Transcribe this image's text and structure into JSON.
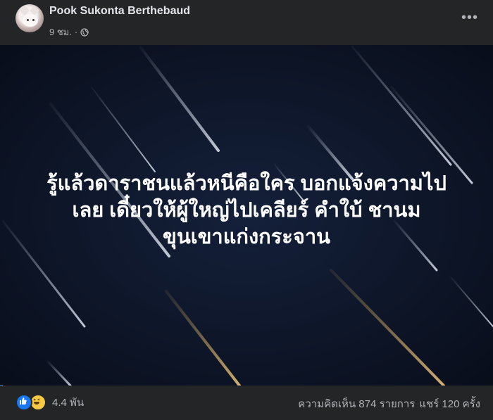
{
  "post": {
    "author": "Pook Sukonta Berthebaud",
    "time": "9 ชม.",
    "separator": "·",
    "privacy_icon": "globe-icon",
    "more_icon": "more-options-icon"
  },
  "image": {
    "caption_lines": [
      "รู้แล้วดาราชนแล้วหนีคือใคร บอกแจ้งความไป",
      "เลย เดี๋ยวให้ผู้ใหญ่ไปเคลียร์ คำใบ้ ชานม",
      "ขุนเขาแก่งกระจาน"
    ],
    "background_color": "#0c1222"
  },
  "footer": {
    "reaction_icons": [
      "like-icon",
      "haha-icon"
    ],
    "reaction_count": "4.4 พัน",
    "comments": "ความคิดเห็น 874 รายการ",
    "shares": "แชร์ 120 ครั้ง"
  }
}
